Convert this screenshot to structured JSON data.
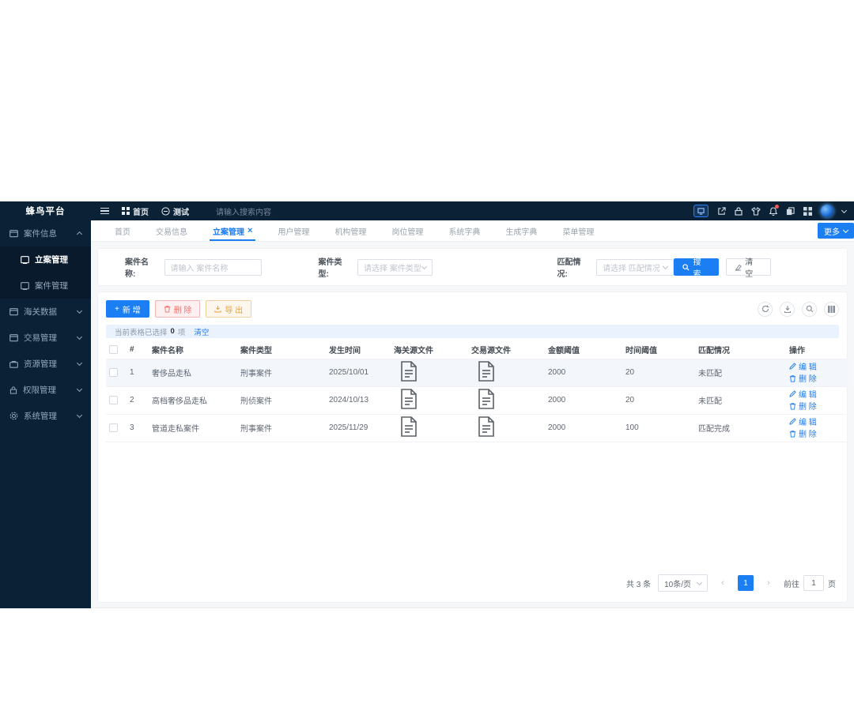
{
  "colors": {
    "primary": "#1b7ef2",
    "dark_navy": "#0b2236",
    "danger": "#f56c6c",
    "warning": "#e6a23c",
    "selection_bar_bg": "#eaf3fd"
  },
  "topbar": {
    "logo": "蜂鸟平台",
    "home_label": "首页",
    "page_label": "测试",
    "search_placeholder": "请输入搜索内容",
    "icons": [
      "monitor-icon",
      "external-link-icon",
      "lock-icon",
      "theme-icon",
      "bell-icon",
      "copy-icon",
      "apps-grid-icon",
      "avatar",
      "chevron-down-icon"
    ]
  },
  "sidebar": {
    "items": [
      {
        "label": "案件信息",
        "expanded": true,
        "children": [
          {
            "label": "立案管理",
            "active": true
          },
          {
            "label": "案件管理"
          }
        ]
      },
      {
        "label": "海关数据"
      },
      {
        "label": "交易管理"
      },
      {
        "label": "资源管理"
      },
      {
        "label": "权限管理"
      },
      {
        "label": "系统管理"
      }
    ]
  },
  "tabs": {
    "items": [
      {
        "label": "首页"
      },
      {
        "label": "交易信息"
      },
      {
        "label": "立案管理",
        "active": true,
        "closable": true
      },
      {
        "label": "用户管理"
      },
      {
        "label": "机构管理"
      },
      {
        "label": "岗位管理"
      },
      {
        "label": "系统字典"
      },
      {
        "label": "生成字典"
      },
      {
        "label": "菜单管理"
      }
    ],
    "close_glyph": "×",
    "more_label": "更多"
  },
  "filters": {
    "name_label": "案件名称:",
    "name_placeholder": "请输入 案件名称",
    "type_label": "案件类型:",
    "type_placeholder": "请选择 案件类型",
    "match_label": "匹配情况:",
    "match_placeholder": "请选择 匹配情况",
    "search_label": "搜 索",
    "reset_label": "清 空"
  },
  "toolbar": {
    "add_label": "新 增",
    "plus_glyph": "+",
    "delete_label": "删 除",
    "export_label": "导 出",
    "right_icons": [
      "refresh-icon",
      "export-icon",
      "zoom-icon",
      "column-setting-icon"
    ]
  },
  "selection": {
    "text_before": "当前表格已选择",
    "count": "0",
    "text_after": "项",
    "clear_label": "清空"
  },
  "table": {
    "headers": {
      "index": "#",
      "name": "案件名称",
      "type": "案件类型",
      "date": "发生时间",
      "customs_file": "海关源文件",
      "trade_file": "交易源文件",
      "amount": "金额阈值",
      "time": "时间阈值",
      "match": "匹配情况",
      "op": "操作"
    },
    "rows": [
      {
        "index": "1",
        "name": "奢侈品走私",
        "type": "刑事案件",
        "date": "2025/10/01",
        "amount": "2000",
        "time": "20",
        "match": "未匹配"
      },
      {
        "index": "2",
        "name": "高档奢侈品走私",
        "type": "刑侦案件",
        "date": "2024/10/13",
        "amount": "2000",
        "time": "20",
        "match": "未匹配"
      },
      {
        "index": "3",
        "name": "管道走私案件",
        "type": "刑事案件",
        "date": "2025/11/29",
        "amount": "2000",
        "time": "100",
        "match": "匹配完成"
      }
    ],
    "edit_label": "编 辑",
    "delete_label": "删 除"
  },
  "pagination": {
    "total": "共 3 条",
    "page_size": "10条/页",
    "prev_glyph": "‹",
    "next_glyph": "›",
    "current_page": "1",
    "goto_label": "前往",
    "goto_value": "1",
    "page_unit": "页"
  }
}
